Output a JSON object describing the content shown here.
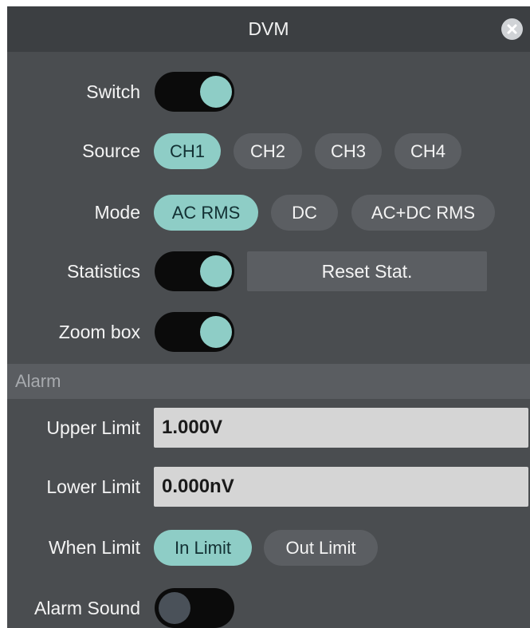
{
  "dialog": {
    "title": "DVM",
    "close_icon": "close-icon"
  },
  "switch": {
    "label": "Switch",
    "state": "on"
  },
  "source": {
    "label": "Source",
    "options": [
      "CH1",
      "CH2",
      "CH3",
      "CH4"
    ],
    "selected": "CH1"
  },
  "mode": {
    "label": "Mode",
    "options": [
      "AC RMS",
      "DC",
      "AC+DC RMS"
    ],
    "selected": "AC RMS"
  },
  "statistics": {
    "label": "Statistics",
    "state": "on",
    "reset_label": "Reset Stat."
  },
  "zoom_box": {
    "label": "Zoom box",
    "state": "on"
  },
  "alarm": {
    "section_title": "Alarm",
    "upper_limit_label": "Upper Limit",
    "upper_limit_value": "1.000V",
    "lower_limit_label": "Lower Limit",
    "lower_limit_value": "0.000nV",
    "when_limit_label": "When Limit",
    "when_limit_options": [
      "In Limit",
      "Out Limit"
    ],
    "when_limit_selected": "In Limit",
    "alarm_sound_label": "Alarm Sound",
    "alarm_sound_state": "off"
  },
  "colors": {
    "accent": "#8ecdc6",
    "panel_bg": "#4a4d50",
    "titlebar_bg": "#3c3f42",
    "button_bg": "#5b5e62",
    "field_bg": "#d5d5d5"
  }
}
